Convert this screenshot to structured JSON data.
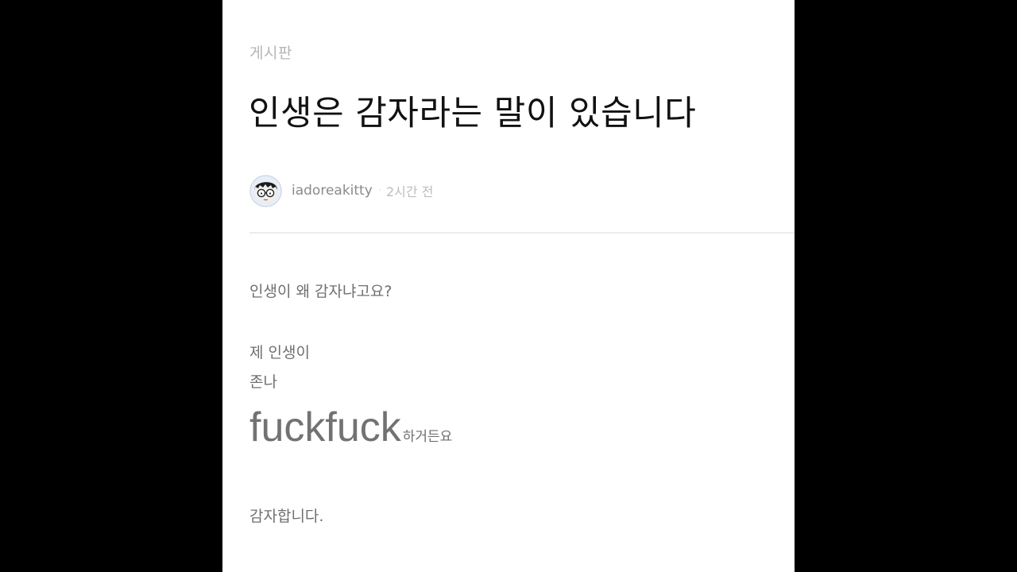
{
  "post": {
    "board": "게시판",
    "title": "인생은 감자라는 말이 있습니다",
    "author": "iadoreakitty",
    "separator": "·",
    "time": "2시간 전"
  },
  "body": {
    "line1": "인생이 왜 감자냐고요?",
    "line2": "제 인생이",
    "line3": "존나",
    "line4_big": "fuckfuck",
    "line4_small": "하거든요",
    "line5": "감자합니다."
  },
  "colors": {
    "background": "#000000",
    "panel": "#ffffff",
    "title": "#111111",
    "body_text": "#6f6f6f",
    "muted": "#b5b5b5"
  },
  "icons": {
    "avatar": "cartoon-avatar-with-glasses"
  }
}
